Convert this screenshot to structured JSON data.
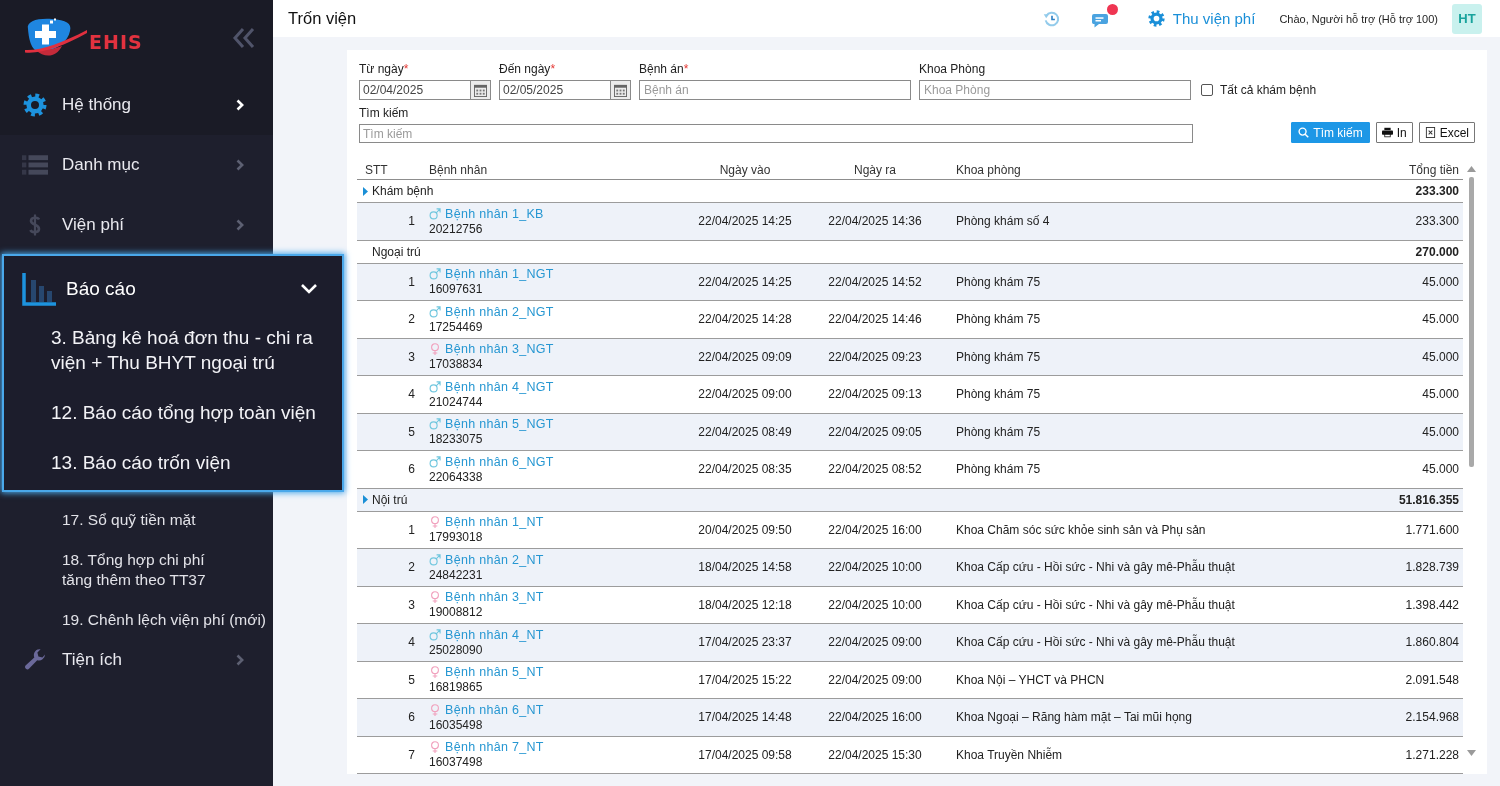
{
  "sidebar": {
    "logo": {
      "text": "EHIS"
    },
    "items": [
      {
        "label": "Hệ thống",
        "selected": true,
        "expanded": false,
        "highlighted": false
      },
      {
        "label": "Danh mục",
        "selected": false,
        "expanded": false,
        "highlighted": false
      },
      {
        "label": "Viện phí",
        "selected": false,
        "expanded": false,
        "highlighted": false
      },
      {
        "label": "Báo cáo",
        "selected": false,
        "expanded": true,
        "highlighted": true,
        "children": [
          {
            "label": "3. Bảng kê hoá đơn thu - chi ra viện + Thu BHYT ngoại trú",
            "highlighted": true
          },
          {
            "label": "12. Báo cáo tổng hợp toàn viện",
            "highlighted": true
          },
          {
            "label": "13. Báo cáo trốn viện",
            "highlighted": true
          },
          {
            "label": "17. Sổ quỹ tiền mặt",
            "highlighted": false
          },
          {
            "label": "18. Tổng hợp chi phí\ntăng thêm theo TT37",
            "highlighted": false
          },
          {
            "label": "19. Chênh lệch viện phí (mới)",
            "highlighted": false
          }
        ]
      },
      {
        "label": "Tiện ích",
        "selected": false,
        "expanded": false,
        "highlighted": false
      }
    ]
  },
  "topbar": {
    "title": "Trốn viện",
    "has_notification": true,
    "module": "Thu viện phí",
    "greeting": "Chào, Người hỗ trợ (Hỗ trợ 100)",
    "avatar": "HT"
  },
  "filters": {
    "fields": [
      {
        "label": "Từ ngày",
        "required_mark": "*",
        "kind": "date",
        "value": "02/04/2025"
      },
      {
        "label": "Đến ngày",
        "required_mark": "*",
        "kind": "date",
        "value": "02/05/2025"
      },
      {
        "label": "Bệnh án",
        "required_mark": "*",
        "kind": "text",
        "placeholder": "Bệnh án"
      },
      {
        "label": "Khoa Phòng",
        "kind": "text",
        "placeholder": "Khoa Phòng"
      }
    ],
    "checkbox": {
      "label": "Tất cả khám bệnh",
      "checked": false
    },
    "search": {
      "label": "Tìm kiếm",
      "placeholder": "Tìm kiếm"
    },
    "buttons": [
      {
        "label": "Tìm kiếm",
        "kind": "primary"
      },
      {
        "label": "In",
        "kind": "default"
      },
      {
        "label": "Excel",
        "kind": "default"
      }
    ]
  },
  "table": {
    "columns": [
      "STT",
      "Bệnh nhân",
      "Ngày vào",
      "Ngày ra",
      "Khoa phòng",
      "Tổng tiền"
    ],
    "groups": [
      {
        "name": "Khám bệnh",
        "total": "233.300",
        "has_toggle": true,
        "rows": [
          {
            "stt": "1",
            "kind": "male",
            "name": "Bệnh nhân 1_KB",
            "code": "20212756",
            "admitted": "22/04/2025 14:25",
            "discharged": "22/04/2025 14:36",
            "department": "Phòng khám số 4",
            "amount": "233.300"
          }
        ]
      },
      {
        "name": "Ngoại trú",
        "total": "270.000",
        "has_toggle": false,
        "rows": [
          {
            "stt": "1",
            "kind": "male",
            "name": "Bệnh nhân 1_NGT",
            "code": "16097631",
            "admitted": "22/04/2025 14:25",
            "discharged": "22/04/2025 14:52",
            "department": "Phòng khám 75",
            "amount": "45.000"
          },
          {
            "stt": "2",
            "kind": "male",
            "name": "Bệnh nhân 2_NGT",
            "code": "17254469",
            "admitted": "22/04/2025 14:28",
            "discharged": "22/04/2025 14:46",
            "department": "Phòng khám 75",
            "amount": "45.000"
          },
          {
            "stt": "3",
            "kind": "female",
            "name": "Bệnh nhân 3_NGT",
            "code": "17038834",
            "admitted": "22/04/2025 09:09",
            "discharged": "22/04/2025 09:23",
            "department": "Phòng khám 75",
            "amount": "45.000"
          },
          {
            "stt": "4",
            "kind": "male",
            "name": "Bệnh nhân 4_NGT",
            "code": "21024744",
            "admitted": "22/04/2025 09:00",
            "discharged": "22/04/2025 09:13",
            "department": "Phòng khám 75",
            "amount": "45.000"
          },
          {
            "stt": "5",
            "kind": "male",
            "name": "Bệnh nhân 5_NGT",
            "code": "18233075",
            "admitted": "22/04/2025 08:49",
            "discharged": "22/04/2025 09:05",
            "department": "Phòng khám 75",
            "amount": "45.000"
          },
          {
            "stt": "6",
            "kind": "male",
            "name": "Bệnh nhân 6_NGT",
            "code": "22064338",
            "admitted": "22/04/2025 08:35",
            "discharged": "22/04/2025 08:52",
            "department": "Phòng khám 75",
            "amount": "45.000"
          }
        ]
      },
      {
        "name": "Nội trú",
        "total": "51.816.355",
        "has_toggle": true,
        "rows": [
          {
            "stt": "1",
            "kind": "female",
            "name": "Bệnh nhân 1_NT",
            "code": "17993018",
            "admitted": "20/04/2025 09:50",
            "discharged": "22/04/2025 16:00",
            "department": "Khoa Chăm sóc sức khỏe sinh sản và Phụ sản",
            "amount": "1.771.600"
          },
          {
            "stt": "2",
            "kind": "male",
            "name": "Bệnh nhân 2_NT",
            "code": "24842231",
            "admitted": "18/04/2025 14:58",
            "discharged": "22/04/2025 10:00",
            "department": "Khoa Cấp cứu - Hồi sức - Nhi và gây mê-Phẫu thuật",
            "amount": "1.828.739"
          },
          {
            "stt": "3",
            "kind": "female",
            "name": "Bệnh nhân 3_NT",
            "code": "19008812",
            "admitted": "18/04/2025 12:18",
            "discharged": "22/04/2025 10:00",
            "department": "Khoa Cấp cứu - Hồi sức - Nhi và gây mê-Phẫu thuật",
            "amount": "1.398.442"
          },
          {
            "stt": "4",
            "kind": "male",
            "name": "Bệnh nhân 4_NT",
            "code": "25028090",
            "admitted": "17/04/2025 23:37",
            "discharged": "22/04/2025 09:00",
            "department": "Khoa Cấp cứu - Hồi sức - Nhi và gây mê-Phẫu thuật",
            "amount": "1.860.804"
          },
          {
            "stt": "5",
            "kind": "female",
            "name": "Bệnh nhân 5_NT",
            "code": "16819865",
            "admitted": "17/04/2025 15:22",
            "discharged": "22/04/2025 09:00",
            "department": "Khoa Nội – YHCT và PHCN",
            "amount": "2.091.548"
          },
          {
            "stt": "6",
            "kind": "female",
            "name": "Bệnh nhân 6_NT",
            "code": "16035498",
            "admitted": "17/04/2025 14:48",
            "discharged": "22/04/2025 16:00",
            "department": "Khoa Ngoại – Răng hàm mặt – Tai mũi họng",
            "amount": "2.154.968"
          },
          {
            "stt": "7",
            "kind": "female",
            "name": "Bệnh nhân 7_NT",
            "code": "16037498",
            "admitted": "17/04/2025 09:58",
            "discharged": "22/04/2025 15:30",
            "department": "Khoa Truyền Nhiễm",
            "amount": "1.271.228"
          }
        ]
      }
    ]
  }
}
